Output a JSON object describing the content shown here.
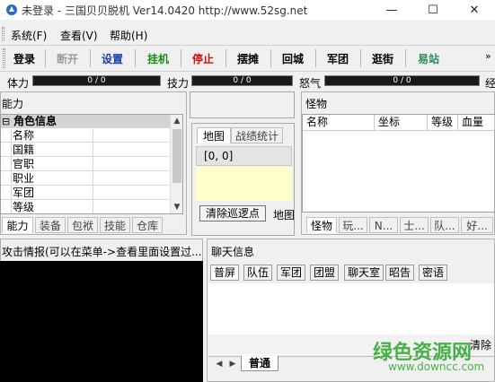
{
  "window": {
    "title": "未登录 - 三国贝贝脱机   Ver14.0420   http://www.52sg.net",
    "minimize": "—",
    "maximize": "☐",
    "close": "✕"
  },
  "menu": [
    "系统(F)",
    "查看(V)",
    "帮助(H)"
  ],
  "toolbar": [
    {
      "label": "登录",
      "color": "#000000"
    },
    {
      "label": "断开",
      "color": "#9a9a9a"
    },
    {
      "label": "设置",
      "color": "#1a3fb0"
    },
    {
      "label": "挂机",
      "color": "#1a8a1a"
    },
    {
      "label": "停止",
      "color": "#cc1010"
    },
    {
      "label": "摆摊",
      "color": "#000000"
    },
    {
      "label": "回城",
      "color": "#000000"
    },
    {
      "label": "军团",
      "color": "#000000"
    },
    {
      "label": "逛街",
      "color": "#000000"
    },
    {
      "label": "易站",
      "color": "#2e8b57"
    }
  ],
  "stats": [
    {
      "label": "体力",
      "value": "0 / 0",
      "fill": 0
    },
    {
      "label": "技力",
      "value": "0 / 0",
      "fill": 0
    },
    {
      "label": "怒气",
      "value": "0 / 0",
      "fill": 0
    },
    {
      "label": "经"
    }
  ],
  "ability": {
    "header": "能力",
    "group_toggle": "⊟",
    "group": "角色信息",
    "rows": [
      "名称",
      "国籍",
      "官职",
      "职业",
      "军团",
      "等级"
    ],
    "tabs": [
      "能力",
      "装备",
      "包袱",
      "技能",
      "仓库"
    ]
  },
  "map": {
    "tabs": [
      "地图",
      "战绩统计"
    ],
    "coords": "[0,  0]",
    "clear_button": "清除巡逻点",
    "cut_label": "地图"
  },
  "monster": {
    "header": "怪物",
    "columns": [
      "名称",
      "坐标",
      "等级",
      "血量"
    ],
    "tabs": [
      "怪物",
      "玩...",
      "N...",
      "士...",
      "队...",
      "好..."
    ]
  },
  "attack": {
    "header": "攻击情报(可以在菜单->查看里面设置过..."
  },
  "chat": {
    "header": "聊天信息",
    "channels": [
      "普屏",
      "队伍",
      "军团",
      "团盟",
      "聊天室",
      "昭告",
      "密语"
    ],
    "clear_label": "清除",
    "sheet_tab": "普通"
  },
  "watermark": {
    "text": "绿色资源网",
    "url": "www.downcc.com",
    "color": "#2aa52a"
  }
}
